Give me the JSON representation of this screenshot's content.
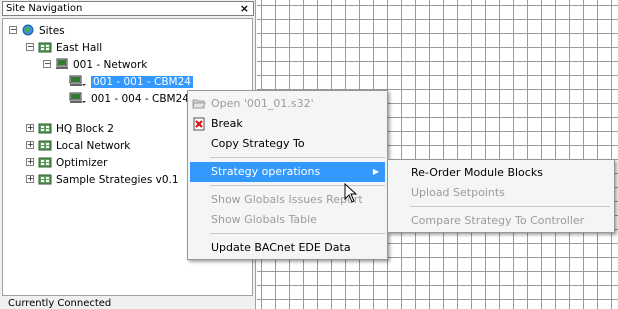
{
  "panel": {
    "title": "Site Navigation",
    "close_glyph": "×",
    "bottom_label": "Currently Connected"
  },
  "tree": [
    {
      "label": "Sites",
      "expander": "−",
      "icon": "globe-icon"
    },
    {
      "label": "East Hall",
      "expander": "−",
      "icon": "building-icon"
    },
    {
      "label": "001 - Network",
      "expander": "−",
      "icon": "network-icon"
    },
    {
      "label": "001 - 001 - CBM24",
      "expander": "",
      "icon": "controller-icon",
      "selected": true
    },
    {
      "label": "001 - 004 - CBM24",
      "expander": "",
      "icon": "controller-icon"
    },
    {
      "label": "HQ Block 2",
      "expander": "+",
      "icon": "building-icon"
    },
    {
      "label": "Local Network",
      "expander": "+",
      "icon": "building-icon"
    },
    {
      "label": "Optimizer",
      "expander": "+",
      "icon": "building-icon"
    },
    {
      "label": "Sample Strategies v0.1",
      "expander": "+",
      "icon": "building-icon"
    }
  ],
  "context_menu": {
    "items": [
      {
        "label": "Open '001_01.s32'",
        "disabled": true,
        "icon": "folder-open-icon"
      },
      {
        "label": "Break",
        "disabled": false,
        "icon": "break-icon"
      },
      {
        "label": "Copy Strategy To",
        "disabled": false
      },
      {
        "label": "Strategy operations",
        "disabled": false,
        "highlighted": true,
        "submenu": true
      },
      {
        "label": "Show Globals Issues Report",
        "disabled": true
      },
      {
        "label": "Show Globals Table",
        "disabled": true
      },
      {
        "label": "Update BACnet EDE Data",
        "disabled": false
      }
    ]
  },
  "submenu": {
    "items": [
      {
        "label": "Re-Order Module Blocks",
        "disabled": false
      },
      {
        "label": "Upload Setpoints",
        "disabled": true
      },
      {
        "label": "Compare Strategy To Controller",
        "disabled": true
      }
    ]
  },
  "colors": {
    "highlight": "#3399ff",
    "disabled_text": "#9c9c9c",
    "grid_line": "#9a9a9a"
  }
}
